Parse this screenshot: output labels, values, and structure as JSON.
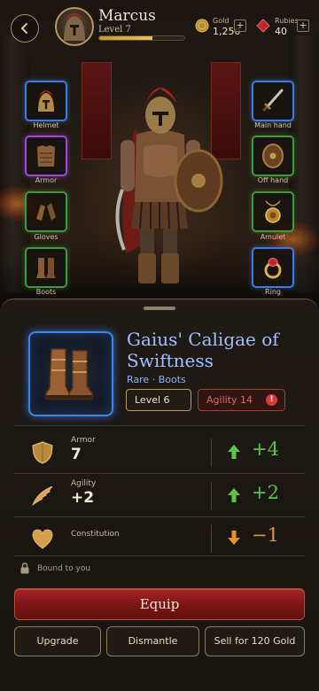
{
  "player": {
    "name": "Marcus",
    "level_label": "Level 7",
    "xp_fraction": 0.62
  },
  "currencies": [
    {
      "label": "Gold",
      "value": "1,250",
      "icon": "gold-coin-icon"
    },
    {
      "label": "Rubies",
      "value": "40",
      "icon": "ruby-icon"
    }
  ],
  "plus_label": "+",
  "slots": {
    "helmet": "Helmet",
    "armor": "Armor",
    "gloves": "Gloves",
    "boots": "Boots",
    "main_hand": "Main hand",
    "off_hand": "Off hand",
    "amulet": "Amulet",
    "ring": "Ring"
  },
  "item": {
    "name": "Gaius' Caligae of Swiftness",
    "rarity": "Rare",
    "separator": "·",
    "type": "Boots",
    "rarity_color": "#3c86f0",
    "req_level": "Level 6",
    "req_agility": "Agility 14",
    "req_agility_warning": "!"
  },
  "stats": [
    {
      "name": "Armor",
      "value": "7",
      "delta": "+4",
      "direction": "up",
      "icon": "shield-icon"
    },
    {
      "name": "Agility",
      "value": "+2",
      "delta": "+2",
      "direction": "up",
      "icon": "wing-icon"
    },
    {
      "name": "Constitution",
      "value": "",
      "delta": "−1",
      "direction": "down",
      "icon": "heart-icon"
    }
  ],
  "bound_text": "Bound to you",
  "buttons": {
    "equip": "Equip",
    "upgrade": "Upgrade",
    "dismantle": "Dismantle",
    "sell": "Sell for 120 Gold"
  },
  "colors": {
    "accent_red": "#8c1a1a",
    "rare_blue": "#3c86f0",
    "gain_green": "#5bc44c",
    "loss_orange": "#e0962b"
  }
}
